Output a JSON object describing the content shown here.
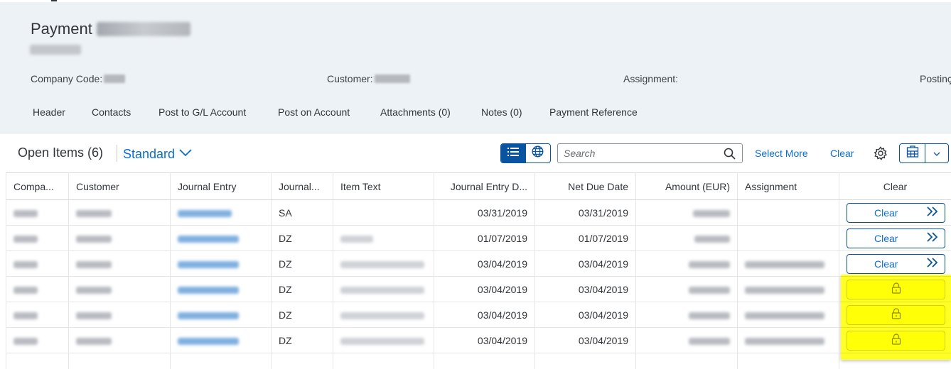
{
  "header": {
    "title": "Payment",
    "attributes": {
      "company_code_label": "Company Code:",
      "customer_label": "Customer:",
      "assignment_label": "Assignment:",
      "posting_label": "Postinç"
    },
    "tabs": [
      {
        "label": "Header"
      },
      {
        "label": "Contacts"
      },
      {
        "label": "Post to G/L Account"
      },
      {
        "label": "Post on Account"
      },
      {
        "label": "Attachments (0)"
      },
      {
        "label": "Notes (0)"
      },
      {
        "label": "Payment Reference"
      }
    ]
  },
  "toolbar": {
    "title": "Open Items (6)",
    "variant": "Standard",
    "search_placeholder": "Search",
    "select_more_label": "Select More",
    "clear_label": "Clear"
  },
  "table": {
    "columns": [
      "Compa...",
      "Customer",
      "Journal Entry",
      "Journal...",
      "Item Text",
      "Journal Entry D...",
      "Net Due Date",
      "Amount (EUR)",
      "Assignment",
      "Clear"
    ],
    "rows": [
      {
        "journal_type": "SA",
        "entry_date": "03/31/2019",
        "net_due_date": "03/31/2019",
        "clear": "Clear",
        "locked": false
      },
      {
        "journal_type": "DZ",
        "entry_date": "01/07/2019",
        "net_due_date": "01/07/2019",
        "clear": "Clear",
        "locked": false
      },
      {
        "journal_type": "DZ",
        "entry_date": "03/04/2019",
        "net_due_date": "03/04/2019",
        "clear": "Clear",
        "locked": false
      },
      {
        "journal_type": "DZ",
        "entry_date": "03/04/2019",
        "net_due_date": "03/04/2019",
        "clear": "",
        "locked": true
      },
      {
        "journal_type": "DZ",
        "entry_date": "03/04/2019",
        "net_due_date": "03/04/2019",
        "clear": "",
        "locked": true
      },
      {
        "journal_type": "DZ",
        "entry_date": "03/04/2019",
        "net_due_date": "03/04/2019",
        "clear": "",
        "locked": true
      }
    ]
  },
  "colors": {
    "brand": "#0a6ed1",
    "header_bg": "#edf2f7",
    "highlight": "#ffff00"
  },
  "icons": {
    "list_view": "list-view-icon",
    "map_view": "globe-icon",
    "search": "search-icon",
    "settings": "gear-icon",
    "export": "export-icon",
    "row_action": "double-chevron-right-icon",
    "locked": "lock-icon"
  }
}
